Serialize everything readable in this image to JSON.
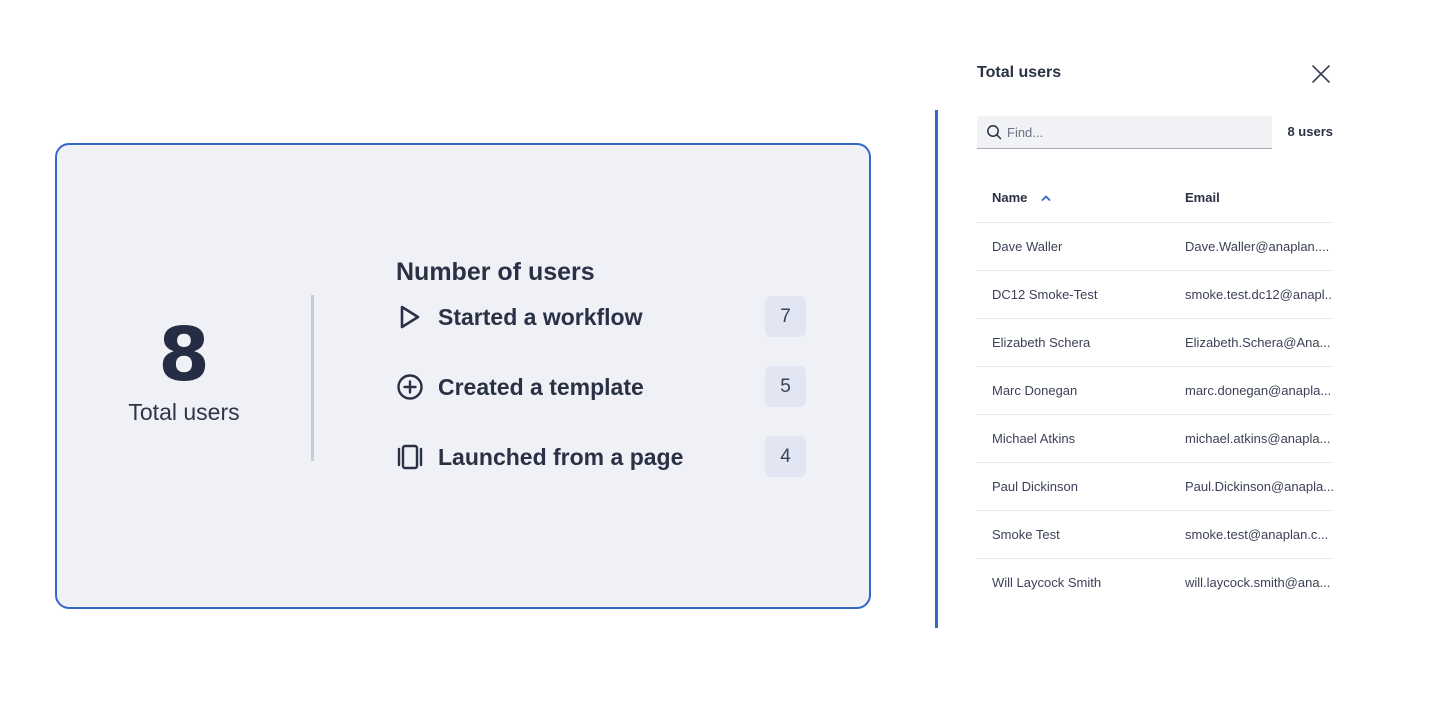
{
  "summary": {
    "total_count": "8",
    "total_label": "Total users",
    "metrics_title": "Number of users",
    "metrics": [
      {
        "icon": "play-outline-icon",
        "label": "Started a workflow",
        "count": "7"
      },
      {
        "icon": "circle-plus-icon",
        "label": "Created a template",
        "count": "5"
      },
      {
        "icon": "page-layers-icon",
        "label": "Launched from a page",
        "count": "4"
      }
    ]
  },
  "panel": {
    "title": "Total users",
    "search_placeholder": "Find...",
    "user_count": "8 users",
    "columns": {
      "name": "Name",
      "email": "Email"
    },
    "sort": {
      "column": "Name",
      "direction": "ascending"
    },
    "rows": [
      {
        "name": "Dave Waller",
        "email": "Dave.Waller@anaplan...."
      },
      {
        "name": "DC12 Smoke-Test",
        "email": "smoke.test.dc12@anapl..."
      },
      {
        "name": "Elizabeth Schera",
        "email": "Elizabeth.Schera@Ana..."
      },
      {
        "name": "Marc Donegan",
        "email": "marc.donegan@anapla..."
      },
      {
        "name": "Michael Atkins",
        "email": "michael.atkins@anapla..."
      },
      {
        "name": "Paul Dickinson",
        "email": "Paul.Dickinson@anapla..."
      },
      {
        "name": "Smoke Test",
        "email": "smoke.test@anaplan.c..."
      },
      {
        "name": "Will Laycock Smith",
        "email": "will.laycock.smith@ana..."
      }
    ]
  },
  "colors": {
    "accent": "#3568c4",
    "card_background": "#eff1f7",
    "text": "#2a3145",
    "badge_background": "#e1e6f2"
  }
}
